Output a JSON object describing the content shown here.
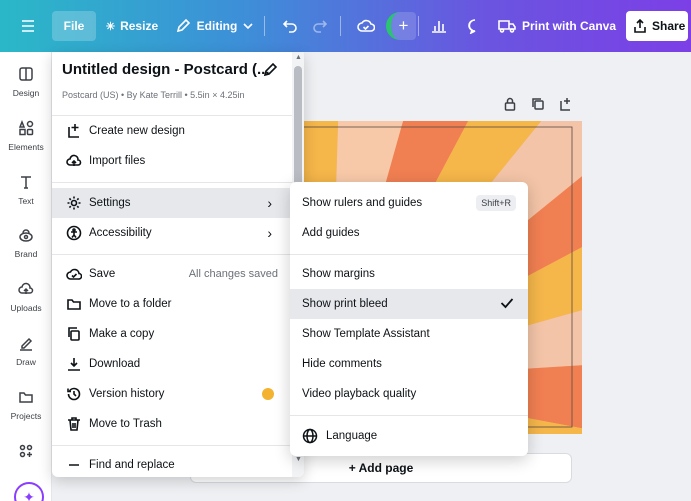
{
  "topbar": {
    "file_label": "File",
    "resize_label": "Resize",
    "editing_label": "Editing",
    "print_label": "Print with Canva",
    "share_label": "Share"
  },
  "rail": {
    "items": [
      {
        "label": "Design",
        "icon": "layout-icon"
      },
      {
        "label": "Elements",
        "icon": "shapes-icon"
      },
      {
        "label": "Text",
        "icon": "text-icon"
      },
      {
        "label": "Brand",
        "icon": "brand-icon"
      },
      {
        "label": "Uploads",
        "icon": "upload-cloud-icon"
      },
      {
        "label": "Draw",
        "icon": "pen-icon"
      },
      {
        "label": "Projects",
        "icon": "folder-icon"
      },
      {
        "label": "",
        "icon": "apps-icon"
      }
    ]
  },
  "file_menu": {
    "title": "Untitled design - Postcard (...",
    "subtitle": "Postcard (US) • By Kate Terrill • 5.5in × 4.25in",
    "items": {
      "create_new": "Create new design",
      "import_files": "Import files",
      "settings": "Settings",
      "accessibility": "Accessibility",
      "save": "Save",
      "save_status": "All changes saved",
      "move_folder": "Move to a folder",
      "make_copy": "Make a copy",
      "download": "Download",
      "version_history": "Version history",
      "move_trash": "Move to Trash",
      "find_replace": "Find and replace"
    }
  },
  "settings_menu": {
    "items": {
      "rulers": "Show rulers and guides",
      "rulers_shortcut": "Shift+R",
      "add_guides": "Add guides",
      "margins": "Show margins",
      "print_bleed": "Show print bleed",
      "template_assistant": "Show Template Assistant",
      "hide_comments": "Hide comments",
      "video_quality": "Video playback quality",
      "language": "Language"
    }
  },
  "canvas": {
    "add_page": "+ Add page"
  },
  "colors": {
    "accent": "#8b3dff",
    "crown": "#f3b330"
  }
}
